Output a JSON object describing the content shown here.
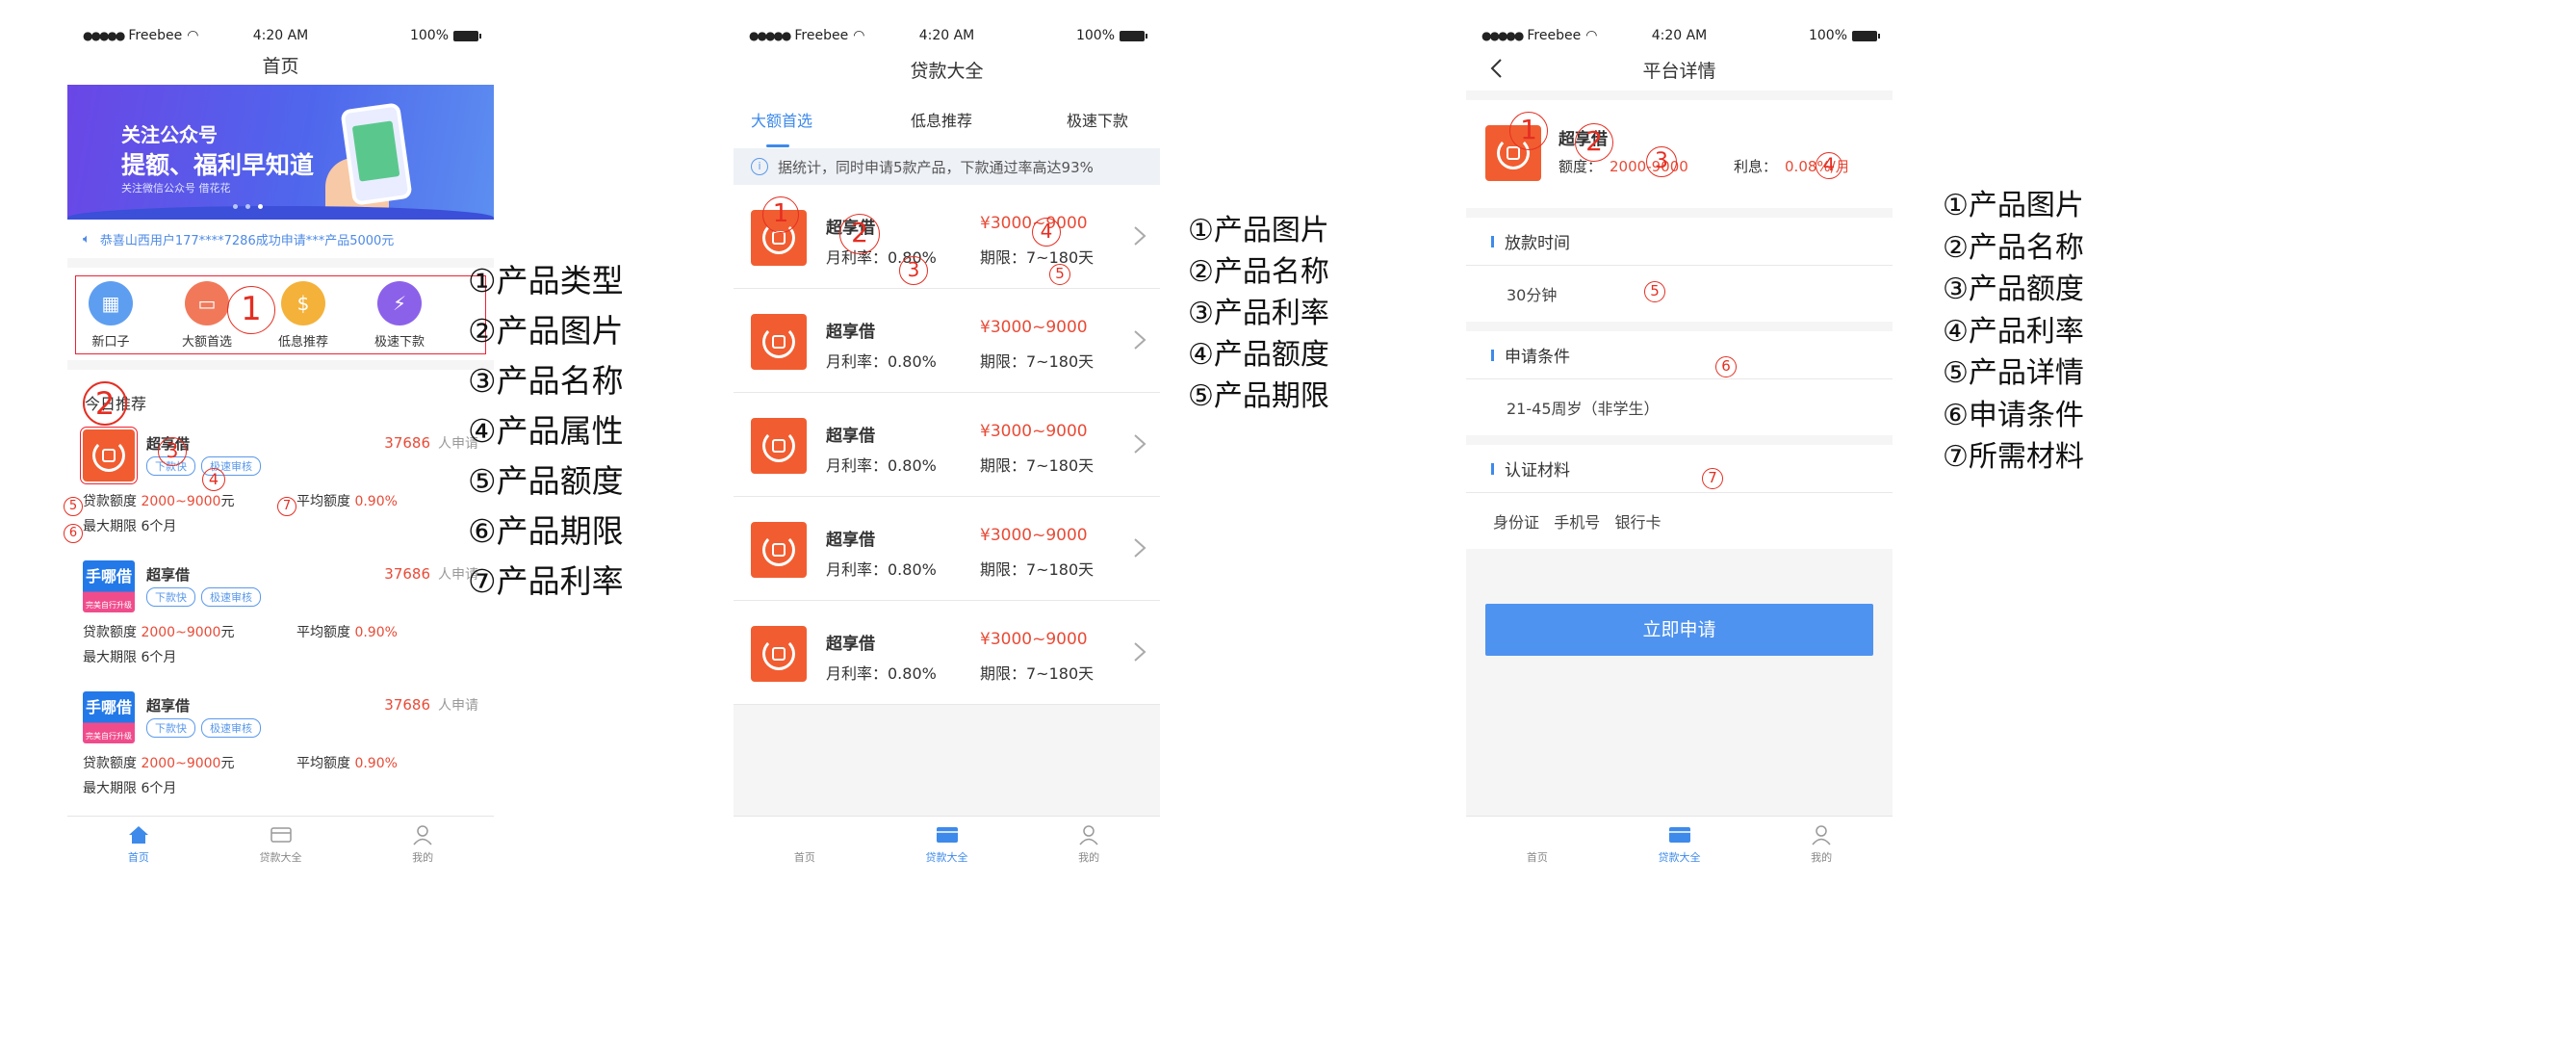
{
  "status": {
    "carrier": "Freebee",
    "time": "4:20 AM",
    "battery": "100%"
  },
  "s1": {
    "title": "首页",
    "banner": {
      "line1": "关注公众号",
      "line2": "提额、福利早知道",
      "line3": "关注微信公众号 借花花"
    },
    "notice": "恭喜山西用户177****7286成功申请***产品5000元",
    "categories": [
      "新口子",
      "大额首选",
      "低息推荐",
      "极速下款"
    ],
    "section_title": "今日推荐",
    "products": [
      {
        "name": "超享借",
        "count": "37686",
        "count_suffix": "人申请",
        "tags": [
          "下款快",
          "极速审核"
        ],
        "amount_label": "贷款额度",
        "amount": "2000~9000",
        "amount_unit": "元",
        "rate_label": "平均额度",
        "rate": "0.90%",
        "term_label": "最大期限",
        "term": "6个月",
        "logo": "orange"
      },
      {
        "name": "超享借",
        "count": "37686",
        "count_suffix": "人申请",
        "tags": [
          "下款快",
          "极速审核"
        ],
        "amount_label": "贷款额度",
        "amount": "2000~9000",
        "amount_unit": "元",
        "rate_label": "平均额度",
        "rate": "0.90%",
        "term_label": "最大期限",
        "term": "6个月",
        "logo": "手哪借",
        "logo_sub": "完美自行升级"
      },
      {
        "name": "超享借",
        "count": "37686",
        "count_suffix": "人申请",
        "tags": [
          "下款快",
          "极速审核"
        ],
        "amount_label": "贷款额度",
        "amount": "2000~9000",
        "amount_unit": "元",
        "rate_label": "平均额度",
        "rate": "0.90%",
        "term_label": "最大期限",
        "term": "6个月",
        "logo": "手哪借",
        "logo_sub": "完美自行升级"
      }
    ],
    "tabbar": [
      "首页",
      "贷款大全",
      "我的"
    ]
  },
  "s2": {
    "title": "贷款大全",
    "tabs": [
      "大额首选",
      "低息推荐",
      "极速下款"
    ],
    "info": "据统计，同时申请5款产品，下款通过率高达93%",
    "items": [
      {
        "name": "超享借",
        "rate": "月利率：0.80%",
        "amount": "¥3000~9000",
        "term": "期限：7~180天"
      },
      {
        "name": "超享借",
        "rate": "月利率：0.80%",
        "amount": "¥3000~9000",
        "term": "期限：7~180天"
      },
      {
        "name": "超享借",
        "rate": "月利率：0.80%",
        "amount": "¥3000~9000",
        "term": "期限：7~180天"
      },
      {
        "name": "超享借",
        "rate": "月利率：0.80%",
        "amount": "¥3000~9000",
        "term": "期限：7~180天"
      },
      {
        "name": "超享借",
        "rate": "月利率：0.80%",
        "amount": "¥3000~9000",
        "term": "期限：7~180天"
      }
    ],
    "tabbar": [
      "首页",
      "贷款大全",
      "我的"
    ]
  },
  "s3": {
    "title": "平台详情",
    "name": "超享借",
    "amount_label": "额度：",
    "amount": "2000-9000",
    "rate_label": "利息：",
    "rate": "0.08%/月",
    "sections": [
      {
        "title": "放款时间",
        "value": "30分钟"
      },
      {
        "title": "申请条件",
        "value": "21-45周岁（非学生）"
      },
      {
        "title": "认证材料",
        "value": "身份证   手机号   银行卡"
      }
    ],
    "button": "立即申请",
    "tabbar": [
      "首页",
      "贷款大全",
      "我的"
    ]
  },
  "notes1": [
    "①产品类型",
    "②产品图片",
    "③产品名称",
    "④产品属性",
    "⑤产品额度",
    "⑥产品期限",
    "⑦产品利率"
  ],
  "notes2": [
    "①产品图片",
    "②产品名称",
    "③产品利率",
    "④产品额度",
    "⑤产品期限"
  ],
  "notes3": [
    "①产品图片",
    "②产品名称",
    "③产品额度",
    "④产品利率",
    "⑤产品详情",
    "⑥申请条件",
    "⑦所需材料"
  ],
  "markers": [
    "1",
    "2",
    "3",
    "4",
    "5",
    "6",
    "7"
  ],
  "colors": {
    "accent": "#3d8aeb",
    "price": "#e84b37",
    "annotation": "#e52e22"
  }
}
